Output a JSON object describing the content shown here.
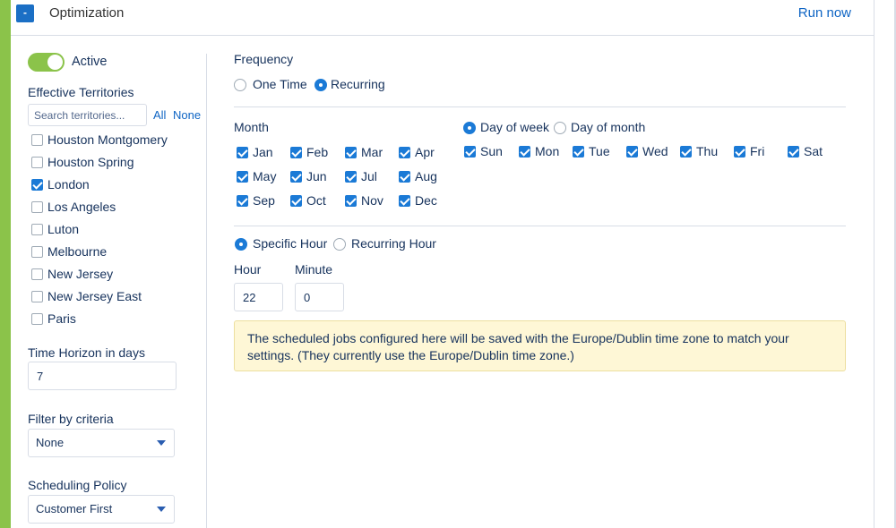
{
  "header": {
    "collapse_label": "-",
    "title": "Optimization",
    "run_now_label": "Run now"
  },
  "active": {
    "label": "Active",
    "enabled": true
  },
  "territories": {
    "label": "Effective Territories",
    "search_placeholder": "Search territories...",
    "all_label": "All",
    "none_label": "None",
    "items": [
      {
        "label": "Houston Montgomery",
        "checked": false
      },
      {
        "label": "Houston Spring",
        "checked": false
      },
      {
        "label": "London",
        "checked": true
      },
      {
        "label": "Los Angeles",
        "checked": false
      },
      {
        "label": "Luton",
        "checked": false
      },
      {
        "label": "Melbourne",
        "checked": false
      },
      {
        "label": "New Jersey",
        "checked": false
      },
      {
        "label": "New Jersey East",
        "checked": false
      },
      {
        "label": "Paris",
        "checked": false
      }
    ]
  },
  "time_horizon": {
    "label": "Time Horizon in days",
    "value": "7"
  },
  "filter": {
    "label": "Filter by criteria",
    "value": "None"
  },
  "policy": {
    "label": "Scheduling Policy",
    "value": "Customer First"
  },
  "frequency": {
    "label": "Frequency",
    "options": [
      {
        "label": "One Time",
        "checked": false
      },
      {
        "label": "Recurring",
        "checked": true
      }
    ]
  },
  "month": {
    "label": "Month",
    "items": [
      {
        "label": "Jan",
        "checked": true
      },
      {
        "label": "Feb",
        "checked": true
      },
      {
        "label": "Mar",
        "checked": true
      },
      {
        "label": "Apr",
        "checked": true
      },
      {
        "label": "May",
        "checked": true
      },
      {
        "label": "Jun",
        "checked": true
      },
      {
        "label": "Jul",
        "checked": true
      },
      {
        "label": "Aug",
        "checked": true
      },
      {
        "label": "Sep",
        "checked": true
      },
      {
        "label": "Oct",
        "checked": true
      },
      {
        "label": "Nov",
        "checked": true
      },
      {
        "label": "Dec",
        "checked": true
      }
    ]
  },
  "day_mode": {
    "options": [
      {
        "label": "Day of week",
        "checked": true
      },
      {
        "label": "Day of month",
        "checked": false
      }
    ]
  },
  "days": [
    {
      "label": "Sun",
      "checked": true
    },
    {
      "label": "Mon",
      "checked": true
    },
    {
      "label": "Tue",
      "checked": true
    },
    {
      "label": "Wed",
      "checked": true
    },
    {
      "label": "Thu",
      "checked": true
    },
    {
      "label": "Fri",
      "checked": true
    },
    {
      "label": "Sat",
      "checked": true
    }
  ],
  "hour_mode": {
    "options": [
      {
        "label": "Specific Hour",
        "checked": true
      },
      {
        "label": "Recurring Hour",
        "checked": false
      }
    ]
  },
  "time": {
    "hour_label": "Hour",
    "hour_value": "22",
    "minute_label": "Minute",
    "minute_value": "0"
  },
  "notice": {
    "text": "The scheduled jobs configured here will be saved with the Europe/Dublin time zone to match your settings. (They currently use the Europe/Dublin time zone.)"
  },
  "colors": {
    "accent": "#8bc34a",
    "brand_blue": "#1b7ad6",
    "link": "#0f65c4",
    "notice_bg": "#fef7d6"
  }
}
